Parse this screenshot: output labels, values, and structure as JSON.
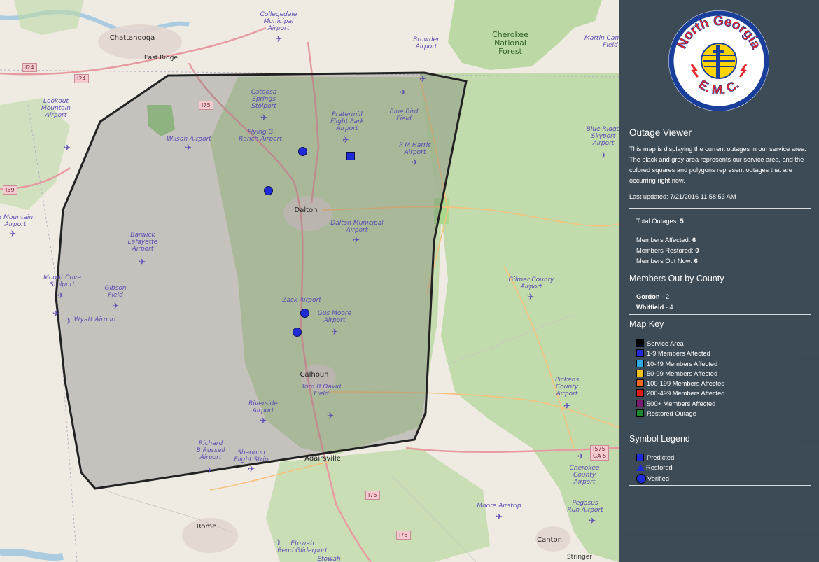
{
  "map": {
    "city_labels": [
      {
        "name": "Chattanooga"
      },
      {
        "name": "East Ridge"
      },
      {
        "name": "Dalton"
      },
      {
        "name": "Calhoun"
      },
      {
        "name": "Adairsville"
      },
      {
        "name": "Rome"
      },
      {
        "name": "Canton"
      }
    ],
    "airport_labels": [
      {
        "name": "Collegedale\nMunicipal\nAirport"
      },
      {
        "name": "Browder\nAirport"
      },
      {
        "name": "Lookout\nMountain\nAirport"
      },
      {
        "name": "Catoosa\nSprings\nStolport"
      },
      {
        "name": "Pratermill\nFlight Park\nAirport"
      },
      {
        "name": "Blue Bird\nField"
      },
      {
        "name": "Flying G\nRanch Airport"
      },
      {
        "name": "Wilson Airport"
      },
      {
        "name": "P M Harris\nAirport"
      },
      {
        "name": "Dalton Municipal\nAirport"
      },
      {
        "name": "Barwick\nLafayette\nAirport"
      },
      {
        "name": "Mount Cove\nStolport"
      },
      {
        "name": "Gibson\nField"
      },
      {
        "name": "Wyatt Airport"
      },
      {
        "name": "Zack Airport"
      },
      {
        "name": "Gus Moore\nAirport"
      },
      {
        "name": "Tom B David\nField"
      },
      {
        "name": "Riverside\nAirport"
      },
      {
        "name": "Richard\nB Russell\nAirport"
      },
      {
        "name": "Shannon\nFlight Strip"
      },
      {
        "name": "Gilmer County\nAirport"
      },
      {
        "name": "Pickens\nCounty\nAirport"
      },
      {
        "name": "Cherokee\nCounty\nAirport"
      },
      {
        "name": "Pegasus\nRun Airport"
      },
      {
        "name": "Moore Airstrip"
      },
      {
        "name": "Etowah\nBend Gliderport"
      },
      {
        "name": "Blue Ridge\nSkyport\nAirport"
      },
      {
        "name": "Martin Campbell\nField"
      },
      {
        "name": "x Mountain\nAirport"
      },
      {
        "name": "Etowah"
      },
      {
        "name": "Stringer"
      }
    ],
    "forest_label": "Cherokee\nNational\nForest",
    "road_shields": [
      "I24",
      "I24",
      "I75",
      "I59",
      "I75",
      "I75",
      "I575\nGA 5"
    ],
    "outages": [
      {
        "symbol": "Verified",
        "members": "1-9"
      },
      {
        "symbol": "Predicted",
        "members": "1-9"
      },
      {
        "symbol": "Verified",
        "members": "1-9"
      },
      {
        "symbol": "Verified",
        "members": "1-9"
      },
      {
        "symbol": "Verified",
        "members": "1-9"
      }
    ]
  },
  "panel": {
    "logo": {
      "top_text": "North Georgia",
      "bottom_text": "E.M.C.",
      "colors": {
        "ring": "#1a3f9a",
        "text": "#e8262b",
        "sun": "#ffd400"
      }
    },
    "title": "Outage Viewer",
    "description": "This map is displaying the current outages in our service area. The black and grey area represents our service area, and the colored squares and polygons represent outages that are occurring right now.",
    "last_updated": "Last updated: 7/21/2016 11:58:53 AM",
    "stats": {
      "total_outages_label": "Total Outages: ",
      "total_outages": "5",
      "members_affected_label": "Members Affected: ",
      "members_affected": "6",
      "members_restored_label": "Members Restored: ",
      "members_restored": "0",
      "members_out_label": "Members Out Now: ",
      "members_out": "6"
    },
    "county_heading": "Members Out by County",
    "counties": [
      {
        "name": "Gordon",
        "value": " - 2"
      },
      {
        "name": "Whitfield",
        "value": " - 4"
      }
    ],
    "map_key_heading": "Map Key",
    "map_key": [
      {
        "label": "Service Area",
        "color": "#000000"
      },
      {
        "label": "1-9 Members Affected",
        "color": "#1f2bd6"
      },
      {
        "label": "10-49 Members Affected",
        "color": "#2fa8e8"
      },
      {
        "label": "50-99 Members Affected",
        "color": "#f5c21b"
      },
      {
        "label": "100-199 Members Affected",
        "color": "#f26b1d"
      },
      {
        "label": "200-499 Members Affected",
        "color": "#e31b1b"
      },
      {
        "label": "500+ Members Affected",
        "color": "#7a1a6e"
      },
      {
        "label": "Restored Outage",
        "color": "#1c8a2a"
      }
    ],
    "symbol_heading": "Symbol Legend",
    "symbols": [
      {
        "label": "Predicted",
        "shape": "square",
        "color": "#1f2bd6"
      },
      {
        "label": "Restored",
        "shape": "triangle",
        "color": "#1f2bd6"
      },
      {
        "label": "Verified",
        "shape": "circle",
        "color": "#1f2bd6"
      }
    ]
  }
}
